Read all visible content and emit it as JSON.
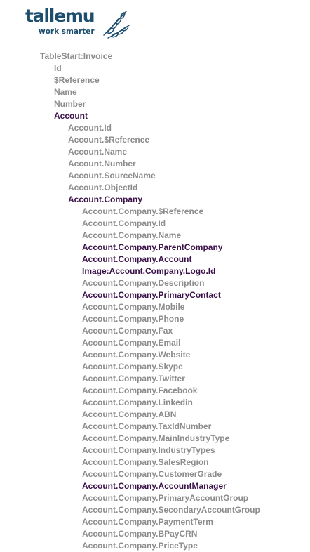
{
  "brand": {
    "name": "tallemu",
    "tagline": "work smarter",
    "logo_icon": "leaf-fronds-icon",
    "primary_color": "#1d4e6e"
  },
  "colors": {
    "field_text": "#8c8c8c",
    "section_text": "#3a1148"
  },
  "tree": [
    {
      "label": "TableStart:Invoice",
      "depth": 0,
      "type": "field"
    },
    {
      "label": "Id",
      "depth": 1,
      "type": "field"
    },
    {
      "label": "$Reference",
      "depth": 1,
      "type": "field"
    },
    {
      "label": "Name",
      "depth": 1,
      "type": "field"
    },
    {
      "label": "Number",
      "depth": 1,
      "type": "field"
    },
    {
      "label": "Account",
      "depth": 1,
      "type": "section"
    },
    {
      "label": "Account.Id",
      "depth": 2,
      "type": "field"
    },
    {
      "label": "Account.$Reference",
      "depth": 2,
      "type": "field"
    },
    {
      "label": "Account.Name",
      "depth": 2,
      "type": "field"
    },
    {
      "label": "Account.Number",
      "depth": 2,
      "type": "field"
    },
    {
      "label": "Account.SourceName",
      "depth": 2,
      "type": "field"
    },
    {
      "label": "Account.ObjectId",
      "depth": 2,
      "type": "field"
    },
    {
      "label": "Account.Company",
      "depth": 2,
      "type": "section"
    },
    {
      "label": "Account.Company.$Reference",
      "depth": 3,
      "type": "field"
    },
    {
      "label": "Account.Company.Id",
      "depth": 3,
      "type": "field"
    },
    {
      "label": "Account.Company.Name",
      "depth": 3,
      "type": "field"
    },
    {
      "label": "Account.Company.ParentCompany",
      "depth": 3,
      "type": "section"
    },
    {
      "label": "Account.Company.Account",
      "depth": 3,
      "type": "section"
    },
    {
      "label": "Image:Account.Company.Logo.Id",
      "depth": 3,
      "type": "section"
    },
    {
      "label": "Account.Company.Description",
      "depth": 3,
      "type": "field"
    },
    {
      "label": "Account.Company.PrimaryContact",
      "depth": 3,
      "type": "section"
    },
    {
      "label": "Account.Company.Mobile",
      "depth": 3,
      "type": "field"
    },
    {
      "label": "Account.Company.Phone",
      "depth": 3,
      "type": "field"
    },
    {
      "label": "Account.Company.Fax",
      "depth": 3,
      "type": "field"
    },
    {
      "label": "Account.Company.Email",
      "depth": 3,
      "type": "field"
    },
    {
      "label": "Account.Company.Website",
      "depth": 3,
      "type": "field"
    },
    {
      "label": "Account.Company.Skype",
      "depth": 3,
      "type": "field"
    },
    {
      "label": "Account.Company.Twitter",
      "depth": 3,
      "type": "field"
    },
    {
      "label": "Account.Company.Facebook",
      "depth": 3,
      "type": "field"
    },
    {
      "label": "Account.Company.Linkedin",
      "depth": 3,
      "type": "field"
    },
    {
      "label": "Account.Company.ABN",
      "depth": 3,
      "type": "field"
    },
    {
      "label": "Account.Company.TaxIdNumber",
      "depth": 3,
      "type": "field"
    },
    {
      "label": "Account.Company.MainIndustryType",
      "depth": 3,
      "type": "field"
    },
    {
      "label": "Account.Company.IndustryTypes",
      "depth": 3,
      "type": "field"
    },
    {
      "label": "Account.Company.SalesRegion",
      "depth": 3,
      "type": "field"
    },
    {
      "label": "Account.Company.CustomerGrade",
      "depth": 3,
      "type": "field"
    },
    {
      "label": "Account.Company.AccountManager",
      "depth": 3,
      "type": "section"
    },
    {
      "label": "Account.Company.PrimaryAccountGroup",
      "depth": 3,
      "type": "field"
    },
    {
      "label": "Account.Company.SecondaryAccountGroup",
      "depth": 3,
      "type": "field"
    },
    {
      "label": "Account.Company.PaymentTerm",
      "depth": 3,
      "type": "field"
    },
    {
      "label": "Account.Company.BPayCRN",
      "depth": 3,
      "type": "field"
    },
    {
      "label": "Account.Company.PriceType",
      "depth": 3,
      "type": "field"
    }
  ]
}
